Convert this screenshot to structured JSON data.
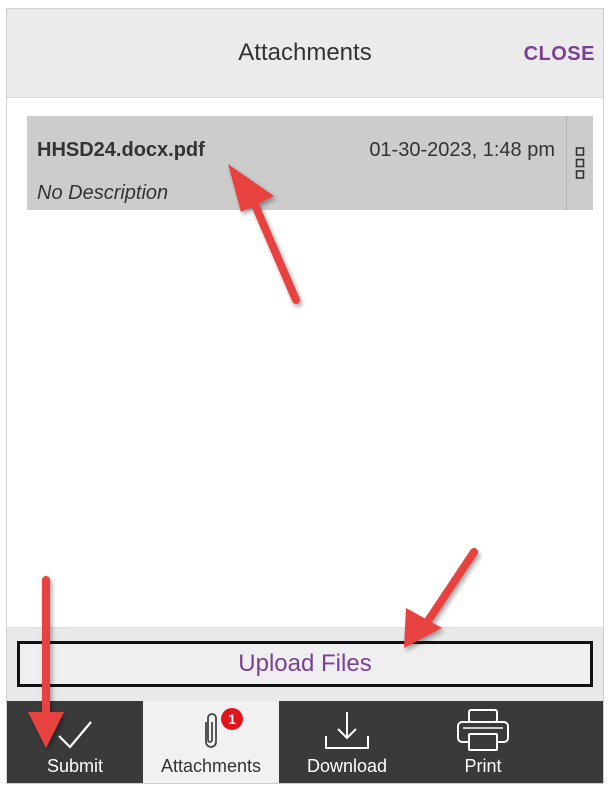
{
  "header": {
    "title": "Attachments",
    "close_label": "CLOSE"
  },
  "attachments": [
    {
      "name": "HHSD24.docx.pdf",
      "date": "01-30-2023, 1:48 pm",
      "description": "No Description"
    }
  ],
  "upload": {
    "label": "Upload Files"
  },
  "toolbar": {
    "items": [
      {
        "label": "Submit",
        "icon": "checkmark-icon",
        "active": false
      },
      {
        "label": "Attachments",
        "icon": "paperclip-icon",
        "active": true,
        "badge": "1"
      },
      {
        "label": "Download",
        "icon": "download-icon",
        "active": false
      },
      {
        "label": "Print",
        "icon": "printer-icon",
        "active": false
      }
    ]
  },
  "colors": {
    "accent": "#7b3f98",
    "toolbar_bg": "#3a3a3a",
    "badge": "#e0161d",
    "annotation_arrow": "#e8423f"
  }
}
